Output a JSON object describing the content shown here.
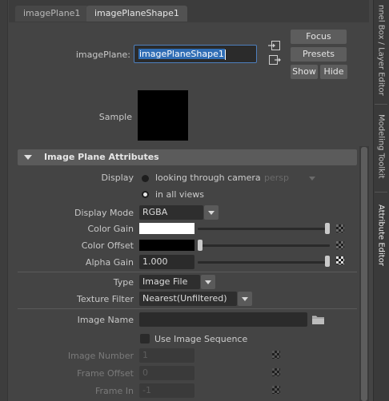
{
  "tabs": [
    "imagePlane1",
    "imagePlaneShape1"
  ],
  "side_tabs": [
    "nnel Box / Layer Editor",
    "Modeling Toolkit",
    "Attribute Editor"
  ],
  "node": {
    "label": "imagePlane:",
    "value": "imagePlaneShape1",
    "focus_label": "Focus",
    "presets_label": "Presets",
    "show_label": "Show",
    "hide_label": "Hide"
  },
  "sample_label": "Sample",
  "section": {
    "title": "Image Plane Attributes"
  },
  "attributes": {
    "display_label": "Display",
    "display_option1": "looking through camera",
    "display_camera": "persp",
    "display_option2": "in all views",
    "display_mode_label": "Display Mode",
    "display_mode_value": "RGBA",
    "color_gain_label": "Color Gain",
    "color_offset_label": "Color Offset",
    "alpha_gain_label": "Alpha Gain",
    "alpha_gain_value": "1.000",
    "type_label": "Type",
    "type_value": "Image File",
    "texture_filter_label": "Texture Filter",
    "texture_filter_value": "Nearest(Unfiltered)",
    "image_name_label": "Image Name",
    "image_name_value": "",
    "use_sequence_label": "Use Image Sequence",
    "image_number_label": "Image Number",
    "image_number_value": "1",
    "frame_offset_label": "Frame Offset",
    "frame_offset_value": "0",
    "frame_in_label": "Frame In",
    "frame_in_value": "-1"
  },
  "colors": {
    "color_gain": "#ffffff",
    "color_offset": "#000000",
    "sample": "#000000",
    "highlight": "#2f6db5"
  },
  "sliders": {
    "color_gain_level": 1.0,
    "color_offset_level": 0.0,
    "alpha_gain_level": 1.0
  },
  "icons": {
    "input_connection": "input-connection-icon",
    "output_connection": "output-connection-icon",
    "folder": "folder-icon",
    "map_button": "checker-map-icon"
  }
}
